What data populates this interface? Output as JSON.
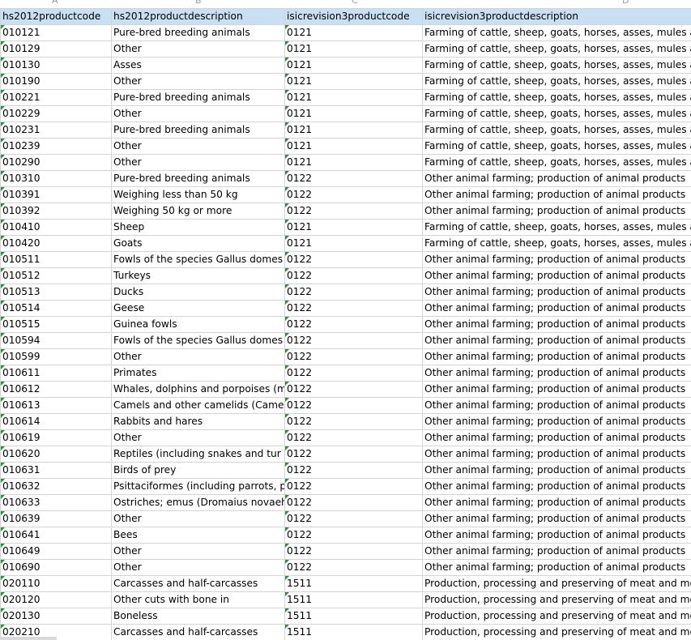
{
  "column_letters": [
    "A",
    "B",
    "C",
    "D"
  ],
  "headers": [
    "hs2012productcode",
    "hs2012productdescription",
    "isicrevision3productcode",
    "isicrevision3productdescription"
  ],
  "rows": [
    [
      "010121",
      "Pure-bred breeding animals",
      "0121",
      "Farming of cattle, sheep, goats, horses, asses, mules a"
    ],
    [
      "010129",
      "Other",
      "0121",
      "Farming of cattle, sheep, goats, horses, asses, mules a"
    ],
    [
      "010130",
      "Asses",
      "0121",
      "Farming of cattle, sheep, goats, horses, asses, mules a"
    ],
    [
      "010190",
      "Other",
      "0121",
      "Farming of cattle, sheep, goats, horses, asses, mules a"
    ],
    [
      "010221",
      "Pure-bred breeding animals",
      "0121",
      "Farming of cattle, sheep, goats, horses, asses, mules a"
    ],
    [
      "010229",
      "Other",
      "0121",
      "Farming of cattle, sheep, goats, horses, asses, mules a"
    ],
    [
      "010231",
      "Pure-bred breeding animals",
      "0121",
      "Farming of cattle, sheep, goats, horses, asses, mules a"
    ],
    [
      "010239",
      "Other",
      "0121",
      "Farming of cattle, sheep, goats, horses, asses, mules a"
    ],
    [
      "010290",
      "Other",
      "0121",
      "Farming of cattle, sheep, goats, horses, asses, mules a"
    ],
    [
      "010310",
      "Pure-bred breeding animals",
      "0122",
      "Other animal farming; production of animal products"
    ],
    [
      "010391",
      "Weighing less than 50 kg",
      "0122",
      "Other animal farming; production of animal products"
    ],
    [
      "010392",
      "Weighing 50 kg or more",
      "0122",
      "Other animal farming; production of animal products"
    ],
    [
      "010410",
      "Sheep",
      "0121",
      "Farming of cattle, sheep, goats, horses, asses, mules a"
    ],
    [
      "010420",
      "Goats",
      "0121",
      "Farming of cattle, sheep, goats, horses, asses, mules a"
    ],
    [
      "010511",
      "Fowls of the species Gallus domes",
      "0122",
      "Other animal farming; production of animal products"
    ],
    [
      "010512",
      "Turkeys",
      "0122",
      "Other animal farming; production of animal products"
    ],
    [
      "010513",
      "Ducks",
      "0122",
      "Other animal farming; production of animal products"
    ],
    [
      "010514",
      "Geese",
      "0122",
      "Other animal farming; production of animal products"
    ],
    [
      "010515",
      "Guinea fowls",
      "0122",
      "Other animal farming; production of animal products"
    ],
    [
      "010594",
      "Fowls of the species Gallus domes",
      "0122",
      "Other animal farming; production of animal products"
    ],
    [
      "010599",
      "Other",
      "0122",
      "Other animal farming; production of animal products"
    ],
    [
      "010611",
      "Primates",
      "0122",
      "Other animal farming; production of animal products"
    ],
    [
      "010612",
      "Whales, dolphins and porpoises (m",
      "0122",
      "Other animal farming; production of animal products"
    ],
    [
      "010613",
      "Camels and other camelids (Came",
      "0122",
      "Other animal farming; production of animal products"
    ],
    [
      "010614",
      "Rabbits and hares",
      "0122",
      "Other animal farming; production of animal products"
    ],
    [
      "010619",
      "Other",
      "0122",
      "Other animal farming; production of animal products"
    ],
    [
      "010620",
      "Reptiles (including snakes and tur",
      "0122",
      "Other animal farming; production of animal products"
    ],
    [
      "010631",
      "Birds of prey",
      "0122",
      "Other animal farming; production of animal products"
    ],
    [
      "010632",
      "Psittaciformes (including parrots, p",
      "0122",
      "Other animal farming; production of animal products"
    ],
    [
      "010633",
      "Ostriches; emus (Dromaius novaeh",
      "0122",
      "Other animal farming; production of animal products"
    ],
    [
      "010639",
      "Other",
      "0122",
      "Other animal farming; production of animal products"
    ],
    [
      "010641",
      "Bees",
      "0122",
      "Other animal farming; production of animal products"
    ],
    [
      "010649",
      "Other",
      "0122",
      "Other animal farming; production of animal products"
    ],
    [
      "010690",
      "Other",
      "0122",
      "Other animal farming; production of animal products"
    ],
    [
      "020110",
      "Carcasses and half-carcasses",
      "1511",
      "Production, processing and preserving of meat and me"
    ],
    [
      "020120",
      "Other cuts with bone in",
      "1511",
      "Production, processing and preserving of meat and me"
    ],
    [
      "020130",
      "Boneless",
      "1511",
      "Production, processing and preserving of meat and me"
    ],
    [
      "020210",
      "Carcasses and half-carcasses",
      "1511",
      "Production, processing and preserving of meat and me"
    ]
  ],
  "colors": {
    "header_fill": "#c9dff4",
    "gridline": "#d4d4d4",
    "text_number_marker": "#2e8b3e"
  }
}
